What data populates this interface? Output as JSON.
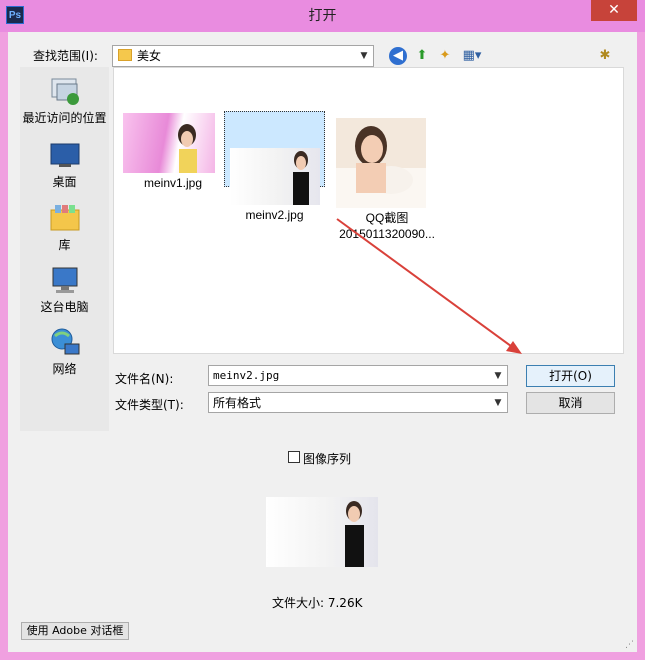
{
  "window": {
    "title": "打开",
    "app_icon_text": "Ps",
    "close_glyph": "✕"
  },
  "lookin": {
    "label": "查找范围(I):",
    "value": "美女"
  },
  "places": [
    {
      "name": "place-recent",
      "label": "最近访问的位置"
    },
    {
      "name": "place-desktop",
      "label": "桌面"
    },
    {
      "name": "place-libraries",
      "label": "库"
    },
    {
      "name": "place-this-pc",
      "label": "这台电脑"
    },
    {
      "name": "place-network",
      "label": "网络"
    }
  ],
  "files": [
    {
      "label": "meinv1.jpg",
      "selected": false
    },
    {
      "label": "meinv2.jpg",
      "selected": true
    },
    {
      "label_line1": "QQ截图",
      "label_line2": "2015011320090...",
      "selected": false
    }
  ],
  "filename": {
    "label": "文件名(N):",
    "value": "meinv2.jpg"
  },
  "filetype": {
    "label": "文件类型(T):",
    "value": "所有格式"
  },
  "buttons": {
    "open": "打开(O)",
    "cancel": "取消",
    "adobe": "使用 Adobe 对话框"
  },
  "image_sequence": {
    "label": "图像序列",
    "checked": false
  },
  "file_size": "文件大小: 7.26K",
  "colors": {
    "titlebar": "#e98ce0",
    "selection": "#cce8ff",
    "arrow": "#d9413a"
  }
}
